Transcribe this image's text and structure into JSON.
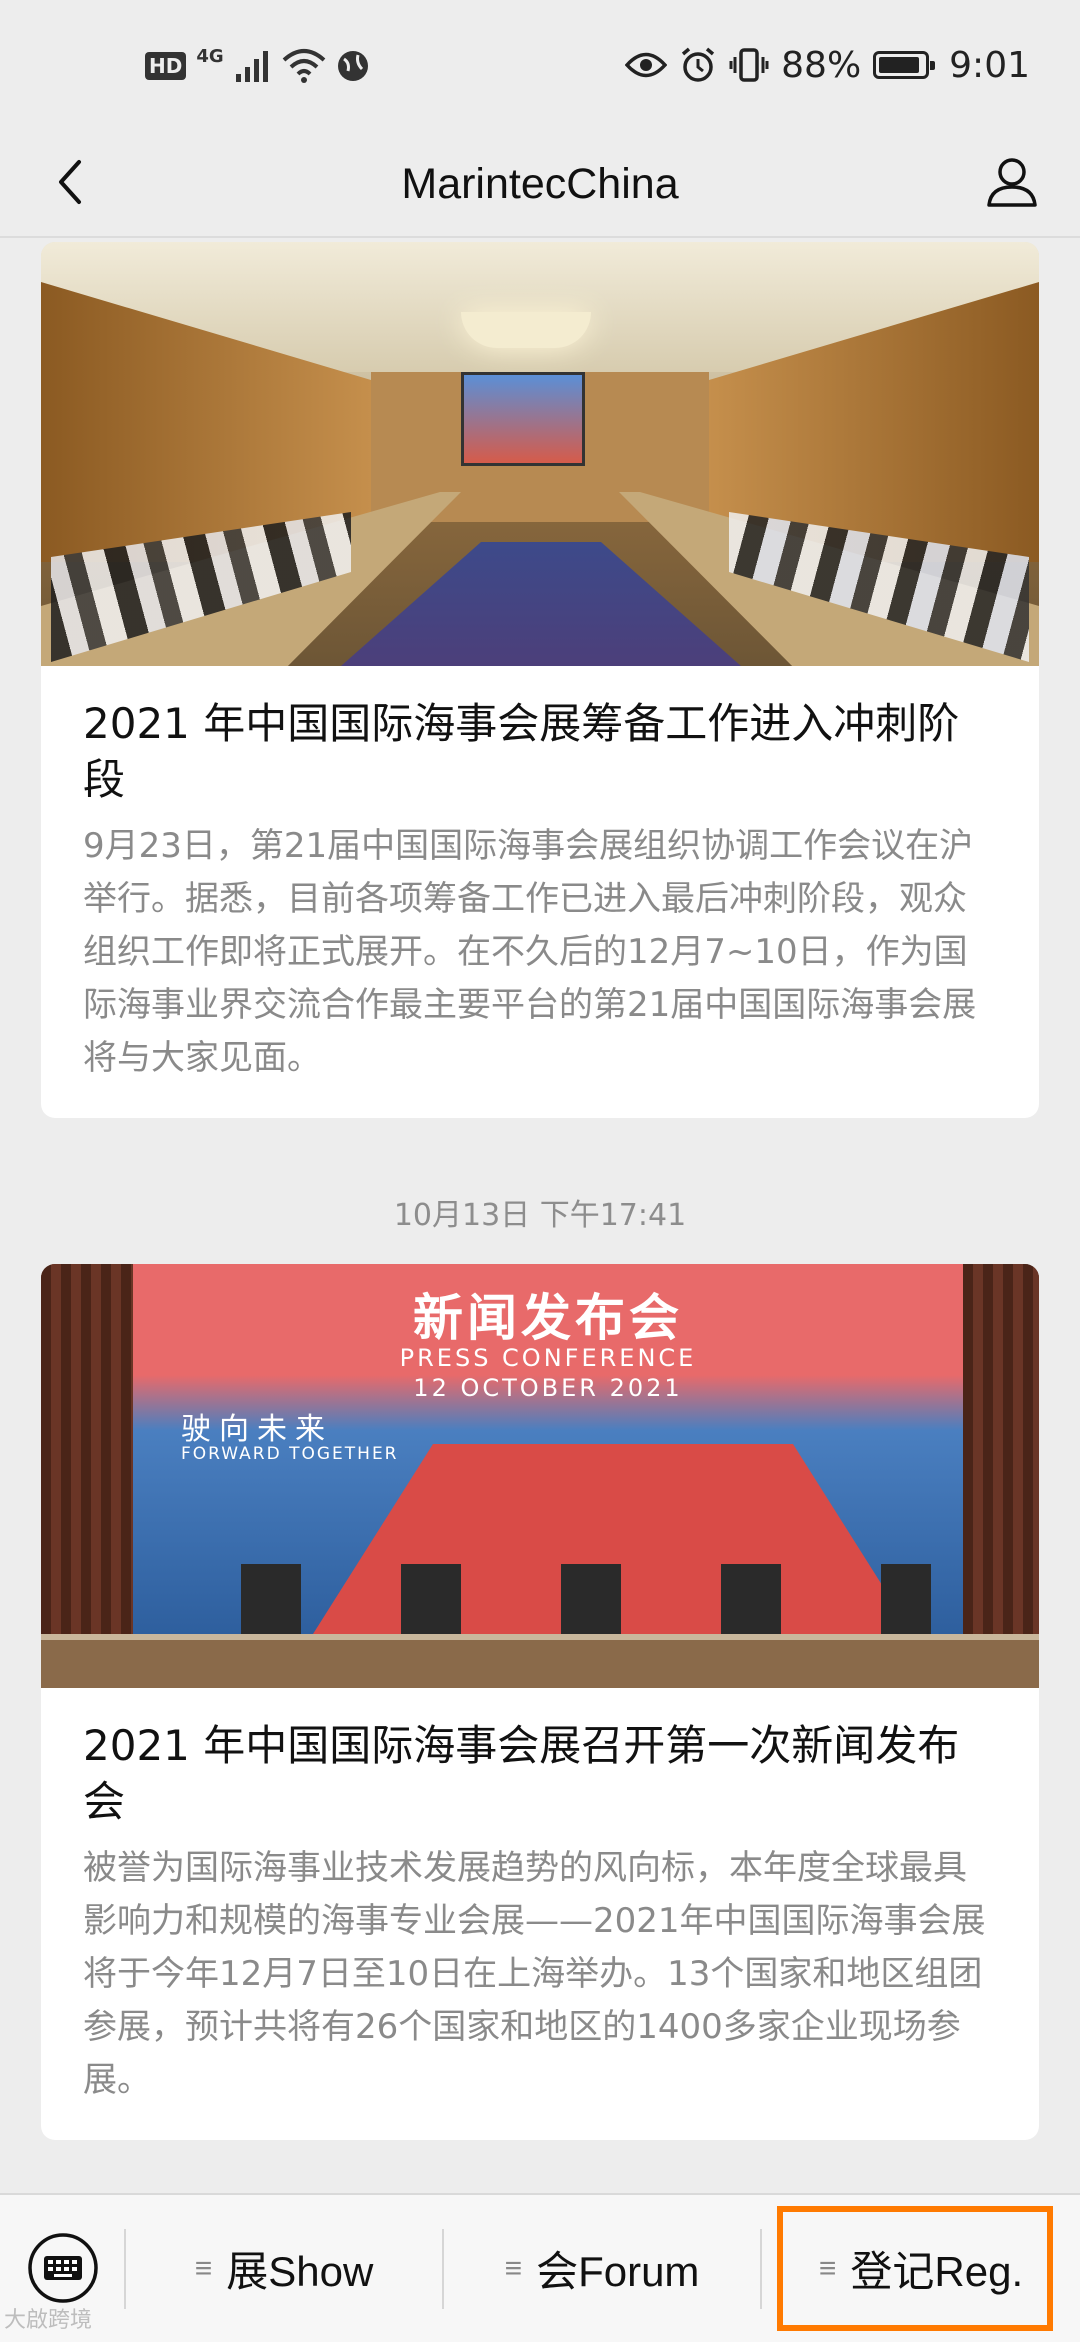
{
  "status_bar": {
    "hd": "HD",
    "network": "4G",
    "battery": "88%",
    "time": "9:01"
  },
  "nav": {
    "title": "MarintecChina"
  },
  "articles": [
    {
      "title": "2021 年中国国际海事会展筹备工作进入冲刺阶段",
      "description": "9月23日，第21届中国国际海事会展组织协调工作会议在沪举行。据悉，目前各项筹备工作已进入最后冲刺阶段，观众组织工作即将正式展开。在不久后的12月7~10日，作为国际海事业界交流合作最主要平台的第21届中国国际海事会展将与大家见面。"
    },
    {
      "title": "2021 年中国国际海事会展召开第一次新闻发布会",
      "description": "被誉为国际海事业技术发展趋势的风向标，本年度全球最具影响力和规模的海事专业会展——2021年中国国际海事会展将于今年12月7日至10日在上海举办。13个国家和地区组团参展，预计共将有26个国家和地区的1400多家企业现场参展。",
      "image_banner": {
        "cn": "新闻发布会",
        "en_line1": "PRESS CONFERENCE",
        "en_line2": "12 OCTOBER 2021",
        "slogan_cn": "驶向未来",
        "slogan_en": "FORWARD TOGETHER"
      }
    }
  ],
  "timestamp": "10月13日 下午17:41",
  "bottom_menu": {
    "items": [
      {
        "label": "展Show"
      },
      {
        "label": "会Forum"
      },
      {
        "label": "登记Reg."
      }
    ],
    "highlight_color": "#ff7a00"
  },
  "watermark": "大啟跨境",
  "icons": {
    "back": "chevron-left-icon",
    "user": "user-icon",
    "keyboard": "keyboard-icon",
    "menu": "hamburger-icon"
  }
}
